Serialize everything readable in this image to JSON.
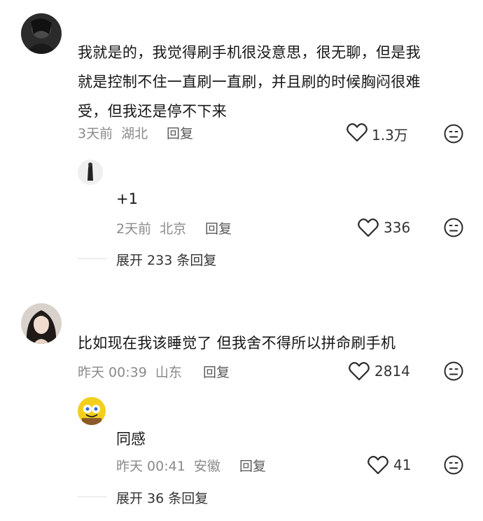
{
  "comments": [
    {
      "text_lines": [
        "我就是的，我觉得刷手机很没意思，很无聊，但是我",
        "就是控制不住一直刷一直刷，并且刷的时候胸闷很难",
        "受，但我还是停不下来"
      ],
      "time": "3天前",
      "location": "湖北",
      "reply_label": "回复",
      "likes": "1.3万",
      "reply": {
        "text": "+1",
        "time": "2天前",
        "location": "北京",
        "reply_label": "回复",
        "likes": "336"
      },
      "expand_label": "展开 233 条回复"
    },
    {
      "text_lines": [
        "比如现在我该睡觉了 但我舍不得所以拼命刷手机"
      ],
      "time": "昨天 00:39",
      "location": "山东",
      "reply_label": "回复",
      "likes": "2814",
      "reply": {
        "text": "同感",
        "time": "昨天 00:41",
        "location": "安徽",
        "reply_label": "回复",
        "likes": "41"
      },
      "expand_label": "展开 36 条回复"
    }
  ],
  "icons": {
    "like": "heart-outline-icon",
    "dislike": "meh-face-icon"
  },
  "colors": {
    "primary_text": "#161616",
    "meta_text": "#8a8a8a",
    "icon": "#2a2a2a"
  }
}
